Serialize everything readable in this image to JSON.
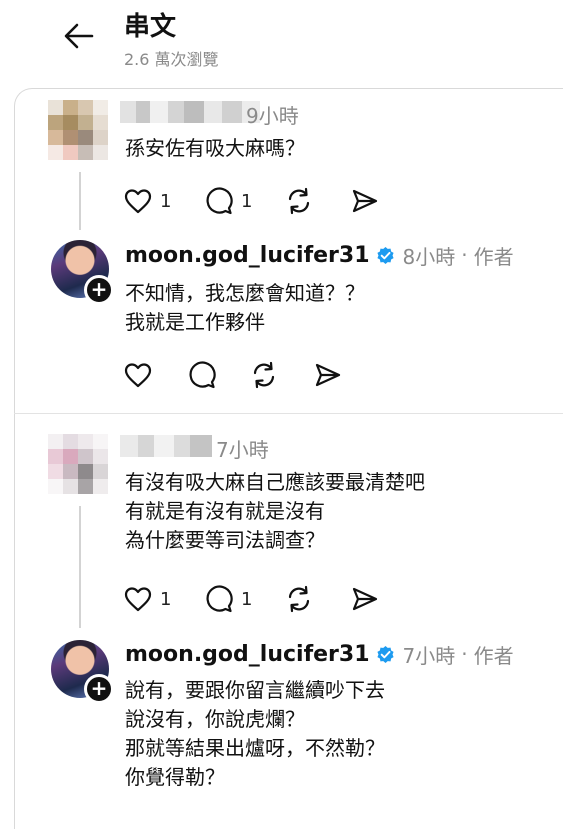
{
  "header": {
    "title": "串文",
    "views": "2.6 萬次瀏覽"
  },
  "icons": {
    "back": "back-arrow-icon",
    "like": "heart-icon",
    "comment": "comment-bubble-icon",
    "repost": "repost-icon",
    "share": "send-icon",
    "verified": "verified-badge-icon",
    "follow": "plus-icon"
  },
  "colors": {
    "verified": "#1d9bf0",
    "muted": "#8a8a8a",
    "text": "#111111"
  },
  "threads": [
    {
      "comment": {
        "time": "9小時",
        "text": "孫安佐有吸大麻嗎？",
        "likes": "1",
        "comments": "1"
      },
      "reply": {
        "username": "moon.god_lucifer31",
        "time": "8小時",
        "author_tag": "作者",
        "text": "不知情，我怎麼會知道？？\n我就是工作夥伴"
      }
    },
    {
      "comment": {
        "time": "7小時",
        "text": "有沒有吸大麻自己應該要最清楚吧\n有就是有沒有就是沒有\n為什麼要等司法調查？",
        "likes": "1",
        "comments": "1"
      },
      "reply": {
        "username": "moon.god_lucifer31",
        "time": "7小時",
        "author_tag": "作者",
        "text": "說有，要跟你留言繼續吵下去\n說沒有，你說虎爛？\n那就等結果出爐呀，不然勒？\n你覺得勒？"
      }
    }
  ]
}
